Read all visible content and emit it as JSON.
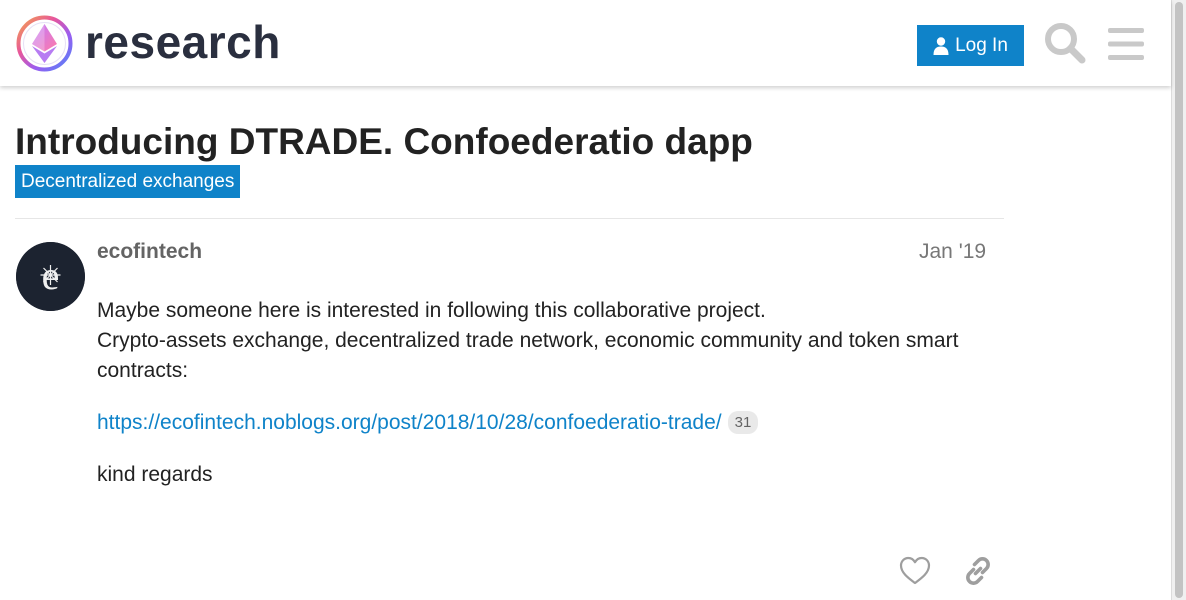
{
  "header": {
    "logo_text": "research",
    "login_label": "Log In"
  },
  "topic": {
    "title": "Introducing DTRADE. Confoederatio dapp",
    "category": "Decentralized exchanges"
  },
  "post": {
    "username": "ecofintech",
    "date": "Jan '19",
    "paragraph1": "Maybe someone here is interested in following this collaborative project.\nCrypto-assets exchange, decentralized trade network, economic community and token smart contracts:",
    "link_text": "https://ecofintech.noblogs.org/post/2018/10/28/confoederatio-trade/",
    "link_clicks": "31",
    "closing": "kind regards"
  },
  "icons": {
    "login": "user-icon",
    "search": "search-icon",
    "menu": "hamburger-menu-icon",
    "like": "heart-icon",
    "share": "link-icon"
  },
  "colors": {
    "accent": "#0f83c9",
    "title": "#222222",
    "muted": "#646464"
  }
}
